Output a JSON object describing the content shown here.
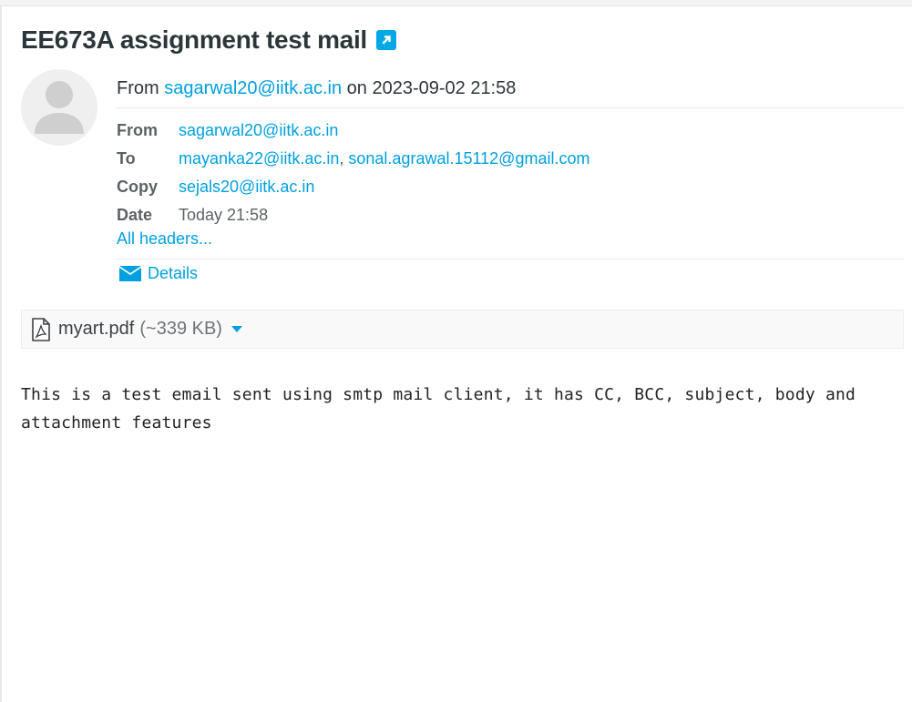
{
  "message": {
    "subject": "EE673A assignment test mail",
    "summary": {
      "from_prefix": "From",
      "from_address": "sagarwal20@iitk.ac.in",
      "on_word": "on",
      "datetime": "2023-09-02 21:58"
    },
    "headers": {
      "from_label": "From",
      "from_value": "sagarwal20@iitk.ac.in",
      "to_label": "To",
      "to_values": [
        "mayanka22@iitk.ac.in",
        "sonal.agrawal.15112@gmail.com"
      ],
      "to_separator": ",",
      "copy_label": "Copy",
      "copy_value": "sejals20@iitk.ac.in",
      "date_label": "Date",
      "date_value": "Today 21:58"
    },
    "all_headers_link": "All headers...",
    "details_link": "Details",
    "attachment": {
      "name": "myart.pdf",
      "size": "(~339 KB)"
    },
    "body": "This is a test email sent using smtp mail client, it has CC, BCC, subject, body and attachment features"
  },
  "icons": {
    "external": "external-link-icon",
    "avatar": "user-avatar-icon",
    "envelope": "envelope-icon",
    "pdf": "pdf-file-icon",
    "caret": "caret-down-icon"
  },
  "colors": {
    "accent": "#00a0e0",
    "text": "#2c363a",
    "muted": "#5b6265"
  }
}
